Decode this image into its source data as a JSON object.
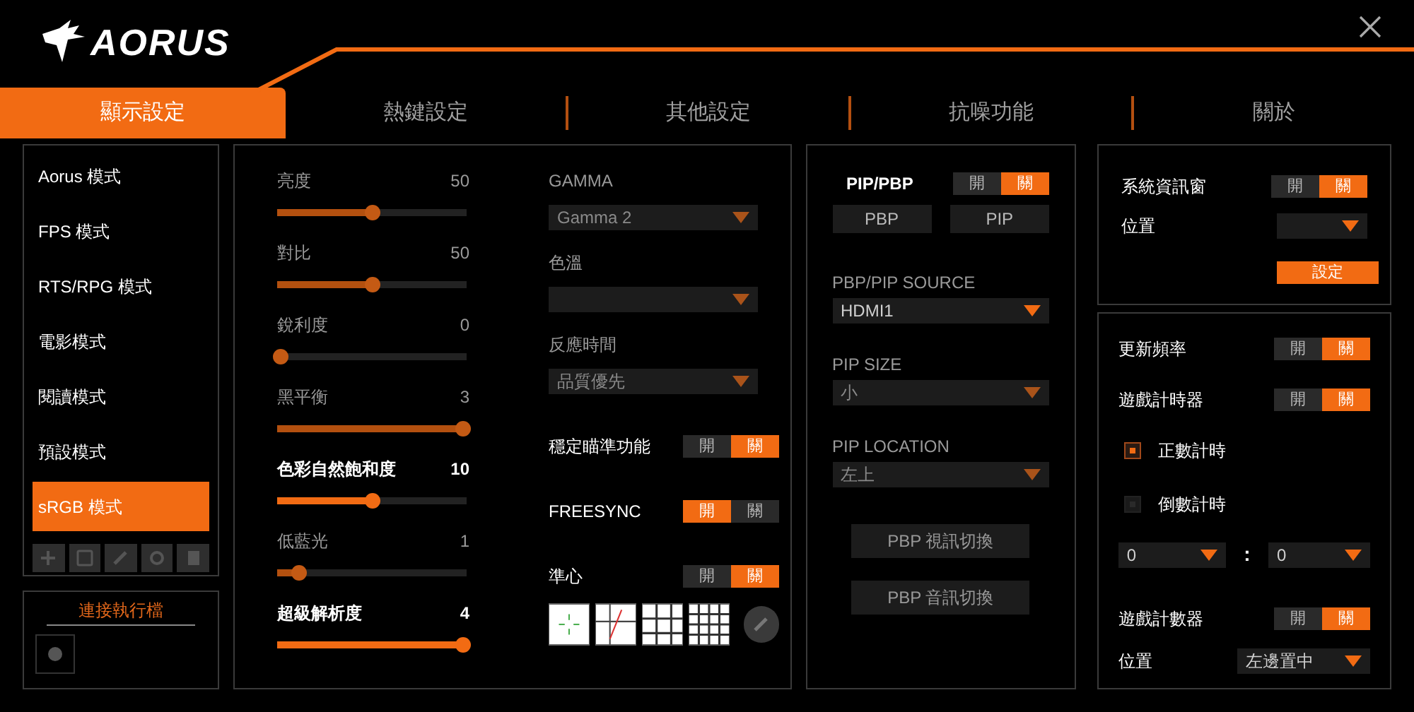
{
  "logo": "AORUS",
  "tabs": [
    {
      "label": "顯示設定",
      "selected": true
    },
    {
      "label": "熱鍵設定",
      "selected": false
    },
    {
      "label": "其他設定",
      "selected": false
    },
    {
      "label": "抗噪功能",
      "selected": false
    },
    {
      "label": "關於",
      "selected": false
    }
  ],
  "modes": [
    {
      "label": "Aorus 模式",
      "selected": false
    },
    {
      "label": "FPS 模式",
      "selected": false
    },
    {
      "label": "RTS/RPG 模式",
      "selected": false
    },
    {
      "label": "電影模式",
      "selected": false
    },
    {
      "label": "閱讀模式",
      "selected": false
    },
    {
      "label": "預設模式",
      "selected": false
    },
    {
      "label": "sRGB 模式",
      "selected": true
    }
  ],
  "app_link": {
    "title": "連接執行檔"
  },
  "sliders": [
    {
      "label": "亮度",
      "reading": "50",
      "level": 0.5,
      "disabled": true
    },
    {
      "label": "對比",
      "reading": "50",
      "level": 0.5,
      "disabled": true
    },
    {
      "label": "銳利度",
      "reading": "0",
      "level": 0,
      "disabled": true
    },
    {
      "label": "黑平衡",
      "reading": "3",
      "level": 1,
      "disabled": true
    },
    {
      "label": "色彩自然飽和度",
      "reading": "10",
      "level": 0.5,
      "disabled": false
    },
    {
      "label": "低藍光",
      "reading": "1",
      "level": 0.1,
      "disabled": true
    },
    {
      "label": "超級解析度",
      "reading": "4",
      "level": 1,
      "disabled": false
    }
  ],
  "picture_selects": [
    {
      "label": "GAMMA",
      "value": "Gamma 2",
      "disabled": true
    },
    {
      "label": "色溫",
      "disabled": true
    },
    {
      "label": "反應時間",
      "value": "品質優先",
      "disabled": true
    }
  ],
  "picture_toggles": [
    {
      "label": "穩定瞄準功能",
      "on_text": "開",
      "off_text": "關",
      "on": false
    },
    {
      "label": "FREESYNC",
      "on_text": "開",
      "off_text": "關",
      "on": true
    },
    {
      "label": "準心",
      "on_text": "開",
      "off_text": "關",
      "on": false
    }
  ],
  "pip": {
    "toggle": {
      "label": "PIP/PBP",
      "on_text": "開",
      "off_text": "關",
      "on": false
    },
    "mode_buttons": [
      "PBP",
      "PIP"
    ],
    "selects": [
      {
        "label": "PBP/PIP SOURCE",
        "value": "HDMI1",
        "disabled": false
      },
      {
        "label": "PIP SIZE",
        "value": "小",
        "disabled": true
      },
      {
        "label": "PIP LOCATION",
        "value": "左上",
        "disabled": true
      }
    ],
    "actions": [
      "PBP 視訊切換",
      "PBP 音訊切換"
    ]
  },
  "dashboard": {
    "toggle": {
      "label": "系統資訊窗",
      "on_text": "開",
      "off_text": "關",
      "on": false
    },
    "position_label": "位置",
    "set_button": "設定"
  },
  "overlay": {
    "refresh": {
      "label": "更新頻率",
      "on_text": "開",
      "off_text": "關",
      "on": false
    },
    "timer": {
      "label": "遊戲計時器",
      "on_text": "開",
      "off_text": "關",
      "on": false
    },
    "timer_modes": [
      {
        "label": "正數計時",
        "selected": true
      },
      {
        "label": "倒數計時",
        "selected": false
      }
    ],
    "minutes": "0",
    "separator": ":",
    "seconds": "0",
    "counter": {
      "label": "遊戲計數器",
      "on_text": "開",
      "off_text": "關",
      "on": false
    },
    "position_label": "位置",
    "position": "左邊置中"
  }
}
